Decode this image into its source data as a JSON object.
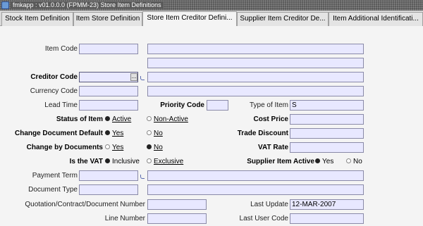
{
  "window": {
    "title": "fmkapp : v01.0.0.0 (FPMM-23) Store Item Definitions",
    "icon": "app-icon"
  },
  "tabs": [
    {
      "label": "Stock Item Definition"
    },
    {
      "label": "Item Store Definition"
    },
    {
      "label": "Store Item Creditor Defini..."
    },
    {
      "label": "Supplier Item Creditor De..."
    },
    {
      "label": "Item Additional Identificati..."
    }
  ],
  "active_tab": 2,
  "form": {
    "item_code": {
      "label": "Item Code",
      "value": ""
    },
    "creditor_code": {
      "label": "Creditor Code",
      "value": ""
    },
    "currency_code": {
      "label": "Currency Code",
      "value": ""
    },
    "lead_time": {
      "label": "Lead Time",
      "value": ""
    },
    "priority_code": {
      "label": "Priority Code",
      "value": ""
    },
    "type_of_item": {
      "label": "Type of Item",
      "value": "S"
    },
    "status_of_item": {
      "label": "Status of Item",
      "options": [
        {
          "label": "Active",
          "selected": true
        },
        {
          "label": "Non-Active",
          "selected": false
        }
      ]
    },
    "cost_price": {
      "label": "Cost Price",
      "value": ""
    },
    "change_document_default": {
      "label": "Change Document Default",
      "options": [
        {
          "label": "Yes",
          "selected": true
        },
        {
          "label": "No",
          "selected": false
        }
      ]
    },
    "trade_discount": {
      "label": "Trade Discount",
      "value": ""
    },
    "change_by_documents": {
      "label": "Change by Documents",
      "options": [
        {
          "label": "Yes",
          "selected": false
        },
        {
          "label": "No",
          "selected": true
        }
      ]
    },
    "vat_rate": {
      "label": "VAT Rate",
      "value": ""
    },
    "is_the_vat": {
      "label": "Is the VAT",
      "options": [
        {
          "label": "Inclusive",
          "selected": true
        },
        {
          "label": "Exclusive",
          "selected": false
        }
      ]
    },
    "supplier_item_active": {
      "label": "Supplier Item Active",
      "options": [
        {
          "label": "Yes",
          "selected": true
        },
        {
          "label": "No",
          "selected": false
        }
      ]
    },
    "payment_term": {
      "label": "Payment Term",
      "value": ""
    },
    "document_type": {
      "label": "Document Type",
      "value": ""
    },
    "quotation_number": {
      "label": "Quotation/Contract/Document Number",
      "value": ""
    },
    "last_update": {
      "label": "Last Update",
      "value": "12-MAR-2007"
    },
    "line_number": {
      "label": "Line Number",
      "value": ""
    },
    "last_user_code": {
      "label": "Last User Code",
      "value": ""
    },
    "lov_button": "..."
  }
}
